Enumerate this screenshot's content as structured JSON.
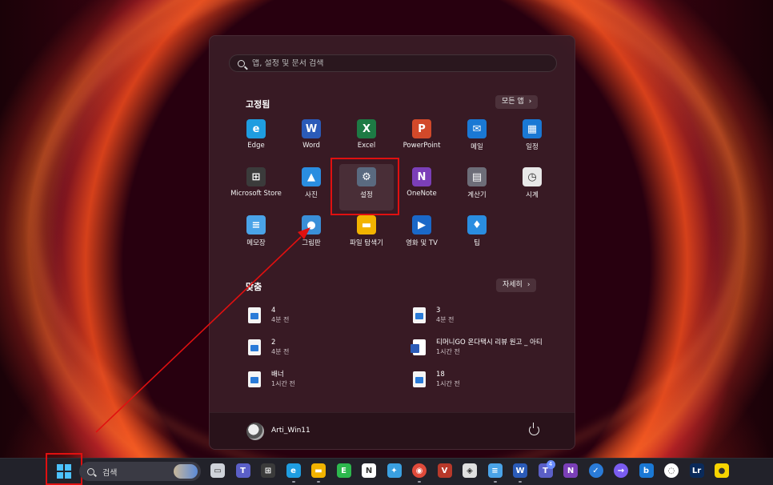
{
  "start_menu": {
    "search_placeholder": "앱, 설정 및 문서 검색",
    "pinned_title": "고정됨",
    "all_apps_label": "모든 앱",
    "pinned_apps": [
      {
        "label": "Edge",
        "icon": "edge-icon",
        "color": "#1f9de0"
      },
      {
        "label": "Word",
        "icon": "word-icon",
        "color": "#2b5bb8"
      },
      {
        "label": "Excel",
        "icon": "excel-icon",
        "color": "#1d7a44"
      },
      {
        "label": "PowerPoint",
        "icon": "powerpoint-icon",
        "color": "#d2492a"
      },
      {
        "label": "메일",
        "icon": "mail-icon",
        "color": "#1a78d4"
      },
      {
        "label": "일정",
        "icon": "calendar-icon",
        "color": "#1a78d4"
      },
      {
        "label": "Microsoft Store",
        "icon": "store-icon",
        "color": "#3b3b3b"
      },
      {
        "label": "사진",
        "icon": "photos-icon",
        "color": "#2a8de0"
      },
      {
        "label": "설정",
        "icon": "gear-icon",
        "color": "#5a6a80"
      },
      {
        "label": "OneNote",
        "icon": "onenote-icon",
        "color": "#7b3fb8"
      },
      {
        "label": "계산기",
        "icon": "calculator-icon",
        "color": "#6d6d78"
      },
      {
        "label": "시계",
        "icon": "clock-icon",
        "color": "#e8e8e8"
      },
      {
        "label": "메모장",
        "icon": "notepad-icon",
        "color": "#4aa3e8"
      },
      {
        "label": "그림판",
        "icon": "paint-icon",
        "color": "#3a8fd8"
      },
      {
        "label": "파일 탐색기",
        "icon": "file-explorer-icon",
        "color": "#f2b300"
      },
      {
        "label": "영화 및 TV",
        "icon": "movies-tv-icon",
        "color": "#1a68c8"
      },
      {
        "label": "팁",
        "icon": "tips-icon",
        "color": "#2a8de0"
      }
    ],
    "recommended_title": "맞춤",
    "more_label": "자세히",
    "recommended": [
      {
        "name": "4",
        "time": "4분 전",
        "type": "image"
      },
      {
        "name": "3",
        "time": "4분 전",
        "type": "image"
      },
      {
        "name": "2",
        "time": "4분 전",
        "type": "image"
      },
      {
        "name": "티머니GO 온다택시 리뷰 원고 _ 아티",
        "time": "1시간 전",
        "type": "word"
      },
      {
        "name": "배너",
        "time": "1시간 전",
        "type": "image"
      },
      {
        "name": "18",
        "time": "1시간 전",
        "type": "image"
      }
    ],
    "user_name": "Arti_Win11"
  },
  "taskbar": {
    "search_label": "검색",
    "badge_count": "4",
    "app_icons": [
      "task-view-icon",
      "teams-icon",
      "store-icon",
      "edge-icon",
      "file-explorer-icon",
      "evernote-icon",
      "notion-icon",
      "bird-icon",
      "chrome-icon",
      "vivaldi-icon",
      "sync-icon",
      "notepad-icon",
      "word-icon",
      "teams-badge-icon",
      "onenote-icon",
      "todo-icon",
      "vpn-icon",
      "bing-icon",
      "naver-icon",
      "lightroom-icon",
      "kakaotalk-icon"
    ]
  }
}
